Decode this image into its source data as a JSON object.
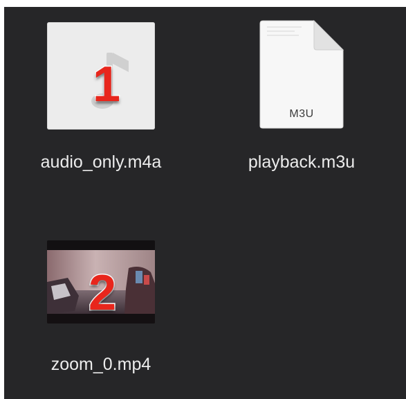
{
  "files": [
    {
      "name": "audio_only.m4a",
      "badge": "1",
      "icon": "audio-file-icon"
    },
    {
      "name": "playback.m3u",
      "extension_label": "M3U",
      "icon": "document-file-icon"
    },
    {
      "name": "zoom_0.mp4",
      "badge": "2",
      "icon": "video-thumbnail-icon"
    }
  ],
  "colors": {
    "background": "#262628",
    "label_text": "#ececec",
    "badge": "#e8261c"
  }
}
